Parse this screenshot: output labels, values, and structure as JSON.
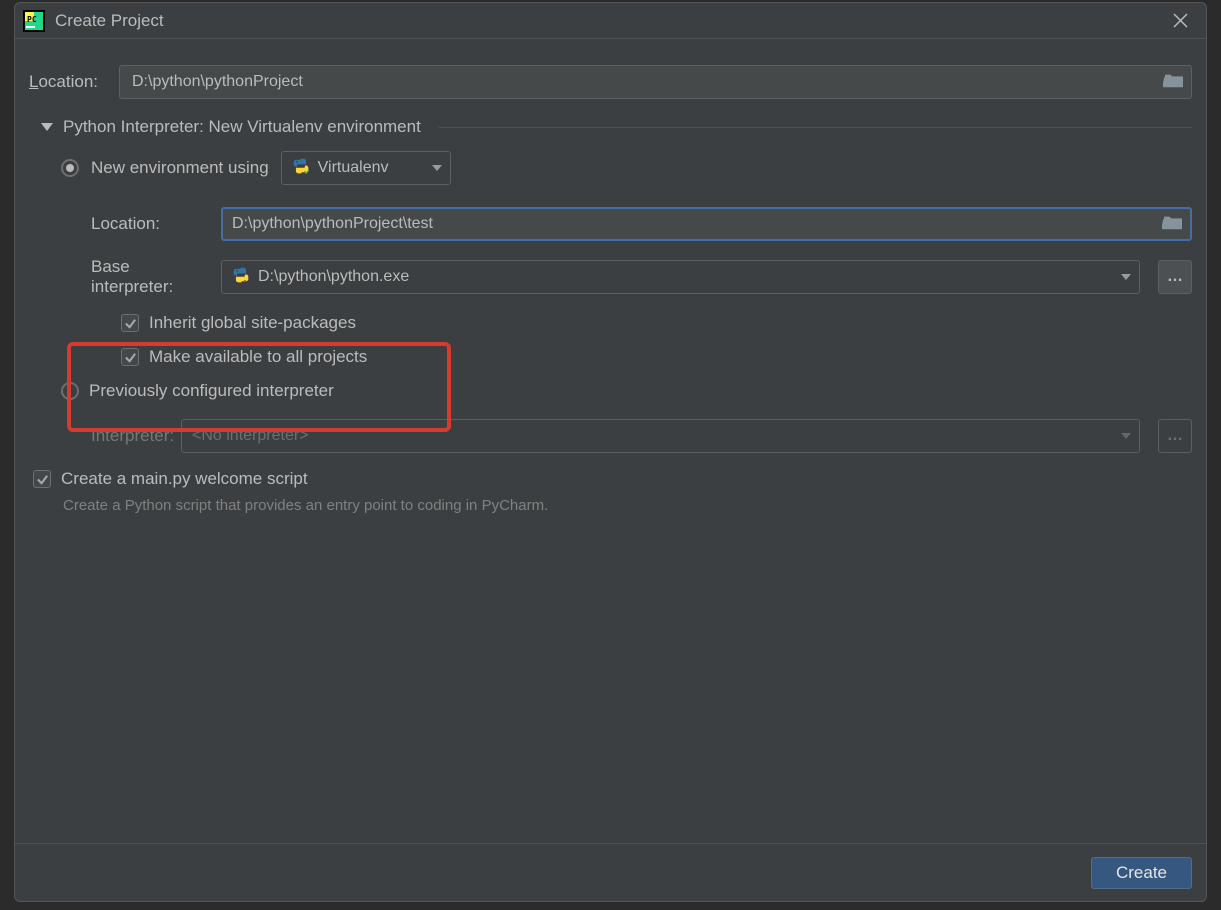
{
  "dialog": {
    "title": "Create Project",
    "location_label_prefix": "L",
    "location_label_rest": "ocation:",
    "location_value": "D:\\python\\pythonProject",
    "interpreter_section": "Python Interpreter: New Virtualenv environment",
    "new_env_label": "New environment using",
    "new_env_tool": "Virtualenv",
    "env_location_label": "Location:",
    "env_location_value": "D:\\python\\pythonProject\\test",
    "base_interpreter_label": "Base interpreter:",
    "base_interpreter_value": "D:\\python\\python.exe",
    "inherit_label": "Inherit global site-packages",
    "make_available_label": "Make available to all projects",
    "prev_configured_label": "Previously configured interpreter",
    "interpreter_label": "Interpreter:",
    "interpreter_value": "<No interpreter>",
    "create_main_label": "Create a main.py welcome script",
    "create_main_descr": "Create a Python script that provides an entry point to coding in PyCharm.",
    "create_button": "Create"
  }
}
